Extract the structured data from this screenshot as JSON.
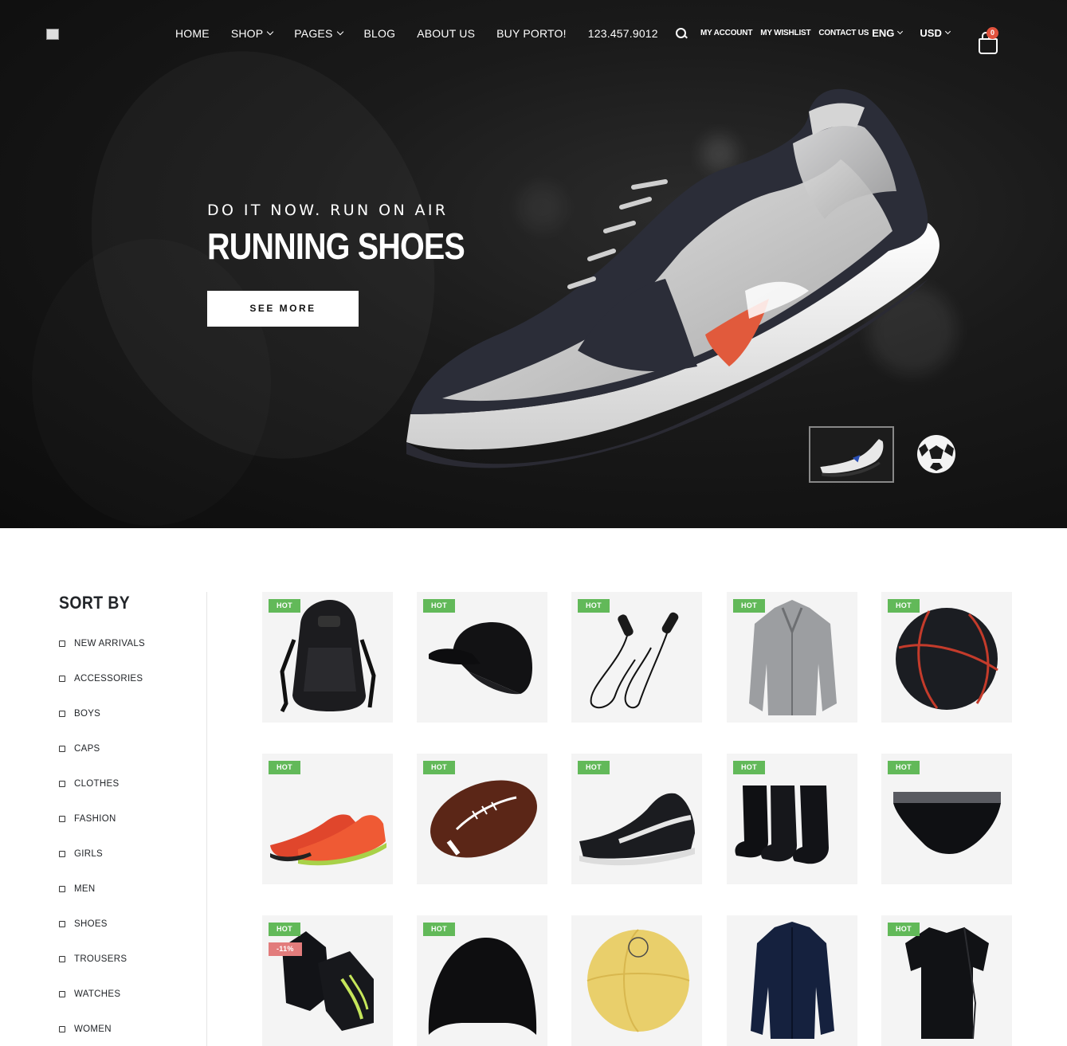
{
  "nav": {
    "items": [
      {
        "label": "HOME",
        "dropdown": false
      },
      {
        "label": "SHOP",
        "dropdown": true
      },
      {
        "label": "PAGES",
        "dropdown": true
      },
      {
        "label": "BLOG",
        "dropdown": false
      },
      {
        "label": "ABOUT US",
        "dropdown": false
      },
      {
        "label": "BUY PORTO!",
        "dropdown": false
      },
      {
        "label": "123.457.9012",
        "dropdown": false
      }
    ]
  },
  "header": {
    "links": [
      "MY ACCOUNT",
      "MY WISHLIST",
      "CONTACT US"
    ],
    "language": "ENG",
    "currency": "USD",
    "cart_count": "0"
  },
  "hero": {
    "subtitle": "DO IT NOW. RUN ON AIR",
    "title": "RUNNING SHOES",
    "button": "SEE MORE",
    "active_slide": 1,
    "slides": [
      "running-shoe",
      "soccer-ball"
    ]
  },
  "sidebar": {
    "title": "SORT BY",
    "filters": [
      "NEW ARRIVALS",
      "ACCESSORIES",
      "BOYS",
      "CAPS",
      "CLOTHES",
      "FASHION",
      "GIRLS",
      "MEN",
      "SHOES",
      "TROUSERS",
      "WATCHES",
      "WOMEN"
    ]
  },
  "products": [
    {
      "name": "backpack",
      "badge": "HOT",
      "sale": ""
    },
    {
      "name": "cap",
      "badge": "HOT",
      "sale": ""
    },
    {
      "name": "jump-rope",
      "badge": "HOT",
      "sale": ""
    },
    {
      "name": "jacket-grey",
      "badge": "HOT",
      "sale": ""
    },
    {
      "name": "basketball",
      "badge": "HOT",
      "sale": ""
    },
    {
      "name": "running-shoes-red",
      "badge": "HOT",
      "sale": ""
    },
    {
      "name": "american-football",
      "badge": "HOT",
      "sale": ""
    },
    {
      "name": "sneaker-black",
      "badge": "HOT",
      "sale": ""
    },
    {
      "name": "socks",
      "badge": "HOT",
      "sale": ""
    },
    {
      "name": "briefs",
      "badge": "HOT",
      "sale": ""
    },
    {
      "name": "gloves",
      "badge": "HOT",
      "sale": "-11%"
    },
    {
      "name": "swim-cap",
      "badge": "HOT",
      "sale": ""
    },
    {
      "name": "soccer-ball-yellow",
      "badge": "",
      "sale": ""
    },
    {
      "name": "track-jacket",
      "badge": "",
      "sale": ""
    },
    {
      "name": "t-shirt",
      "badge": "HOT",
      "sale": ""
    }
  ],
  "colors": {
    "hot_badge": "#62b959",
    "sale_badge": "#e27c7c",
    "cart_badge": "#e2523d"
  }
}
